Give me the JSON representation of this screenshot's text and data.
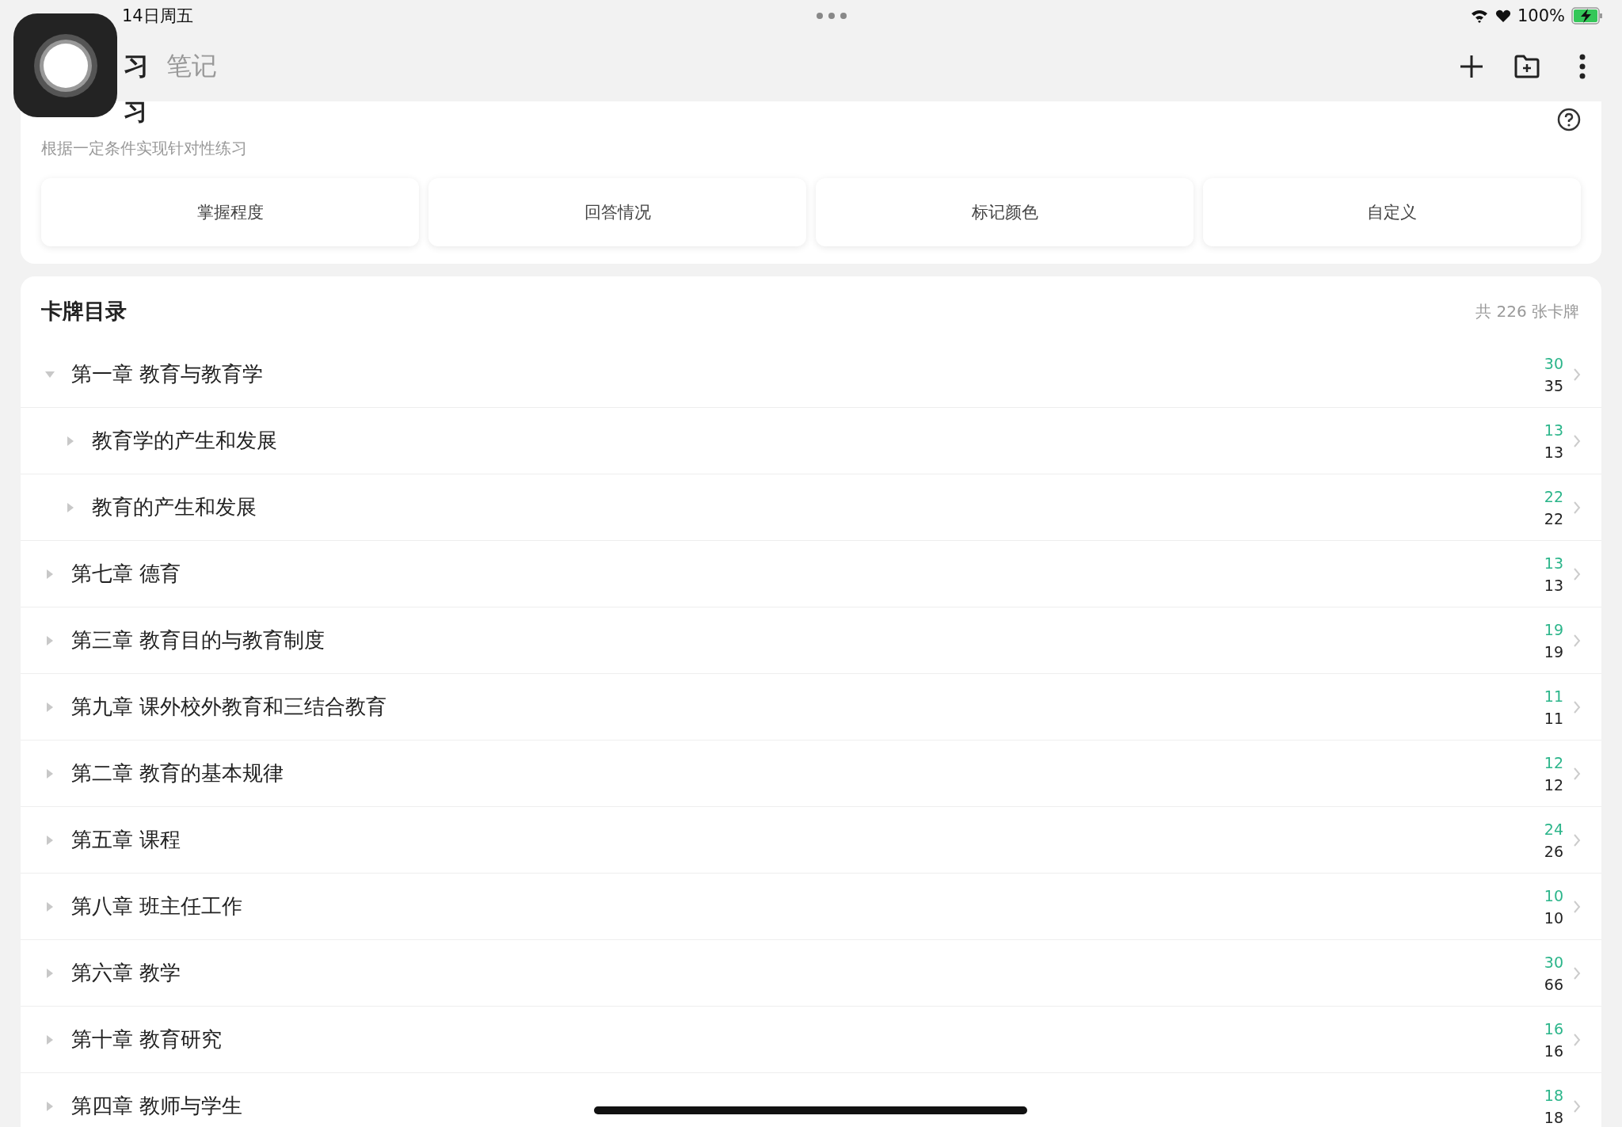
{
  "status_bar": {
    "date": "14日周五",
    "battery": "100%",
    "charging": true
  },
  "header": {
    "tabs": [
      {
        "label": "习",
        "selected": true
      },
      {
        "label": "笔记",
        "selected": false
      }
    ]
  },
  "practice": {
    "title": "习",
    "subtitle": "根据一定条件实现针对性练习",
    "buttons": [
      "掌握程度",
      "回答情况",
      "标记颜色",
      "自定义"
    ]
  },
  "catalog": {
    "title": "卡牌目录",
    "total": "共 226 张卡牌",
    "chapters": [
      {
        "name": "第一章 教育与教育学",
        "learned": "30",
        "total": "35",
        "expanded": true,
        "children": [
          {
            "name": "教育学的产生和发展",
            "learned": "13",
            "total": "13",
            "expanded": false
          },
          {
            "name": "教育的产生和发展",
            "learned": "22",
            "total": "22",
            "expanded": false
          }
        ]
      },
      {
        "name": "第七章 德育",
        "learned": "13",
        "total": "13",
        "expanded": false
      },
      {
        "name": "第三章 教育目的与教育制度",
        "learned": "19",
        "total": "19",
        "expanded": false
      },
      {
        "name": "第九章 课外校外教育和三结合教育",
        "learned": "11",
        "total": "11",
        "expanded": false
      },
      {
        "name": "第二章 教育的基本规律",
        "learned": "12",
        "total": "12",
        "expanded": false
      },
      {
        "name": "第五章 课程",
        "learned": "24",
        "total": "26",
        "expanded": false
      },
      {
        "name": "第八章 班主任工作",
        "learned": "10",
        "total": "10",
        "expanded": false
      },
      {
        "name": "第六章 教学",
        "learned": "30",
        "total": "66",
        "expanded": false
      },
      {
        "name": "第十章 教育研究",
        "learned": "16",
        "total": "16",
        "expanded": false
      },
      {
        "name": "第四章 教师与学生",
        "learned": "18",
        "total": "18",
        "expanded": false
      }
    ]
  }
}
